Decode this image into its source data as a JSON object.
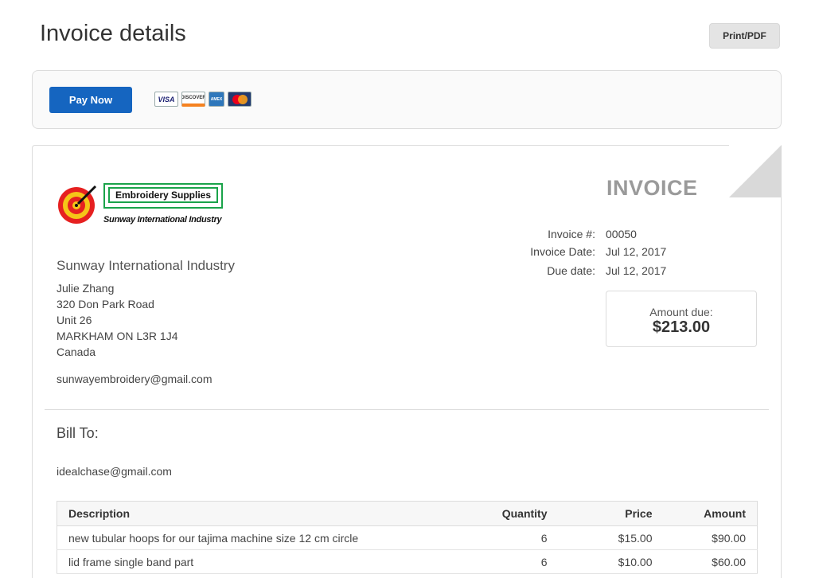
{
  "header": {
    "title": "Invoice details",
    "print_label": "Print/PDF"
  },
  "payment": {
    "pay_label": "Pay Now",
    "cards": [
      {
        "name": "visa",
        "label": "VISA"
      },
      {
        "name": "discover",
        "label": "DISCOVER"
      },
      {
        "name": "amex",
        "label": "AMEX"
      },
      {
        "name": "mastercard",
        "label": ""
      }
    ]
  },
  "logo": {
    "brand": "Embroidery Supplies",
    "tagline": "Sunway International Industry"
  },
  "invoice": {
    "heading": "INVOICE",
    "number_label": "Invoice #:",
    "number": "00050",
    "date_label": "Invoice Date:",
    "date": "Jul 12, 2017",
    "due_label": "Due date:",
    "due": "Jul 12, 2017",
    "amount_label": "Amount due:",
    "amount": "$213.00"
  },
  "seller": {
    "company": "Sunway International Industry",
    "contact": "Julie Zhang",
    "street": "320 Don Park Road",
    "unit": "Unit 26",
    "city": "MARKHAM ON L3R 1J4",
    "country": "Canada",
    "email": "sunwayembroidery@gmail.com"
  },
  "bill_to": {
    "label": "Bill To:",
    "email": "idealchase@gmail.com"
  },
  "table": {
    "headers": [
      "Description",
      "Quantity",
      "Price",
      "Amount"
    ],
    "rows": [
      [
        "new tubular hoops for our tajima machine size 12 cm circle",
        "6",
        "$15.00",
        "$90.00"
      ],
      [
        "lid frame single band part",
        "6",
        "$10.00",
        "$60.00"
      ]
    ]
  },
  "colors": {
    "primary": "#1565c0",
    "invoice_heading": "#9a9a9a",
    "logo_green": "#1aa34a"
  }
}
